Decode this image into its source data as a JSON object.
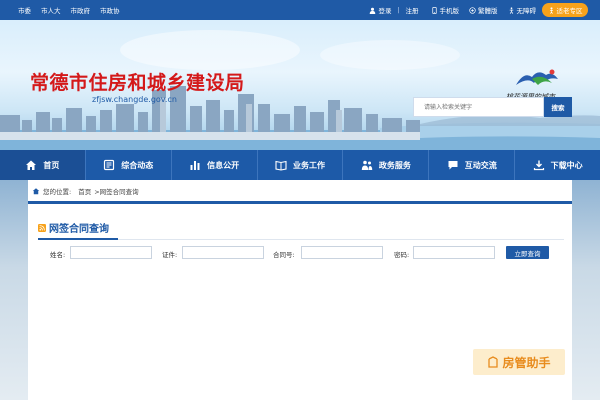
{
  "topbar": {
    "links": [
      "市委",
      "市人大",
      "市政府",
      "市政协"
    ],
    "login": "登录",
    "register": "注册",
    "mobile": "手机版",
    "traditional": "繁體版",
    "accessible": "无障碍",
    "elder_mode": "适老专区"
  },
  "header": {
    "site_title": "常德市住房和城乡建设局",
    "site_url": "zfjsw.changde.gov.cn",
    "city_slogan": "桃花源里的城市",
    "search_placeholder": "请输入检索关键字",
    "search_button": "搜索"
  },
  "nav": {
    "items": [
      {
        "label": "首页",
        "icon": "home-icon"
      },
      {
        "label": "综合动态",
        "icon": "news-icon"
      },
      {
        "label": "信息公开",
        "icon": "chart-icon"
      },
      {
        "label": "业务工作",
        "icon": "book-icon"
      },
      {
        "label": "政务服务",
        "icon": "people-icon"
      },
      {
        "label": "互动交流",
        "icon": "chat-icon"
      },
      {
        "label": "下载中心",
        "icon": "download-icon"
      }
    ]
  },
  "breadcrumb": {
    "prefix": "您的位置:",
    "home": "首页",
    "current": ">网签合同查询"
  },
  "section": {
    "title": "网签合同查询"
  },
  "form": {
    "fields": [
      {
        "label": "姓名:",
        "value": ""
      },
      {
        "label": "证件:",
        "value": ""
      },
      {
        "label": "合同号:",
        "value": ""
      },
      {
        "label": "密码:",
        "value": ""
      }
    ],
    "submit": "立即查询"
  },
  "watermark": {
    "text": "房管助手"
  },
  "colors": {
    "primary": "#1f5aa6",
    "title_red": "#d4191a",
    "elder_orange": "#f7a21b"
  }
}
